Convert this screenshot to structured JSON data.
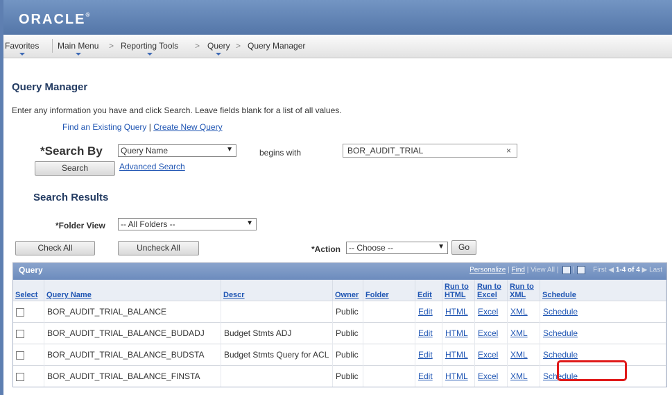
{
  "header": {
    "logo": "ORACLE",
    "logo_mark": "®"
  },
  "navbar": {
    "favorites": "Favorites",
    "main_menu": "Main Menu",
    "reporting_tools": "Reporting Tools",
    "query": "Query",
    "query_manager": "Query Manager",
    "separator": ">"
  },
  "page": {
    "title": "Query Manager",
    "instructions": "Enter any information you have and click Search. Leave fields blank for a list of all values.",
    "find_existing": "Find an Existing Query",
    "link_sep": "|",
    "create_new": "Create New Query"
  },
  "search": {
    "required_mark": "*",
    "search_by_label": "Search By",
    "search_by_value": "Query Name",
    "operator": "begins with",
    "query_value": "BOR_AUDIT_TRIAL",
    "clear_symbol": "×",
    "search_button": "Search",
    "advanced_link": "Advanced Search"
  },
  "results": {
    "heading": "Search Results",
    "folder_view_label": "*Folder View",
    "folder_view_value": "-- All Folders --",
    "check_all": "Check All",
    "uncheck_all": "Uncheck All",
    "action_label": "*Action",
    "action_value": "-- Choose --",
    "go_button": "Go"
  },
  "grid": {
    "title": "Query",
    "personalize": "Personalize",
    "find": "Find",
    "view_all": "View All",
    "first": "First",
    "range": "1-4 of 4",
    "last": "Last",
    "columns": {
      "select": "Select",
      "query_name": "Query Name",
      "descr": "Descr",
      "owner": "Owner",
      "folder": "Folder",
      "edit": "Edit",
      "run_html": "Run to HTML",
      "run_excel": "Run to Excel",
      "run_xml": "Run to XML",
      "schedule": "Schedule"
    },
    "rows": [
      {
        "name": "BOR_AUDIT_TRIAL_BALANCE",
        "descr": "",
        "owner": "Public",
        "folder": "",
        "edit": "Edit",
        "html": "HTML",
        "excel": "Excel",
        "xml": "XML",
        "schedule": "Schedule"
      },
      {
        "name": "BOR_AUDIT_TRIAL_BALANCE_BUDADJ",
        "descr": "Budget Stmts ADJ",
        "owner": "Public",
        "folder": "",
        "edit": "Edit",
        "html": "HTML",
        "excel": "Excel",
        "xml": "XML",
        "schedule": "Schedule"
      },
      {
        "name": "BOR_AUDIT_TRIAL_BALANCE_BUDSTA",
        "descr": "Budget Stmts Query for ACL",
        "owner": "Public",
        "folder": "",
        "edit": "Edit",
        "html": "HTML",
        "excel": "Excel",
        "xml": "XML",
        "schedule": "Schedule"
      },
      {
        "name": "BOR_AUDIT_TRIAL_BALANCE_FINSTA",
        "descr": "",
        "owner": "Public",
        "folder": "",
        "edit": "Edit",
        "html": "HTML",
        "excel": "Excel",
        "xml": "XML",
        "schedule": "Schedule"
      }
    ]
  },
  "colors": {
    "header_blue": "#5e7fb1",
    "link_blue": "#1f55b3",
    "title_navy": "#233b62",
    "highlight_red": "#e01a1a"
  }
}
